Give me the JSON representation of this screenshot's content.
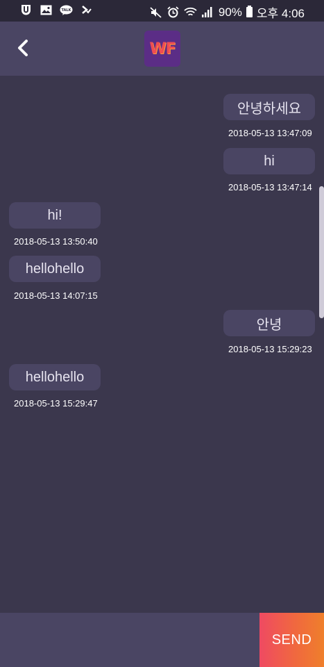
{
  "status_bar": {
    "battery_percent": "90%",
    "time": "오후 4:06",
    "left_icons": [
      "app-u-icon",
      "gallery-icon",
      "kakaotalk-icon",
      "checklist-icon"
    ],
    "right_icons": [
      "mute-icon",
      "alarm-icon",
      "wifi-icon",
      "signal-icon",
      "battery-icon"
    ]
  },
  "header": {
    "logo_text": "WF",
    "back_icon": "chevron-left-icon"
  },
  "messages": [
    {
      "side": "right",
      "text": "안녕하세요",
      "timestamp": "2018-05-13 13:47:09"
    },
    {
      "side": "right",
      "text": "hi",
      "timestamp": "2018-05-13 13:47:14"
    },
    {
      "side": "left",
      "text": "hi!",
      "timestamp": "2018-05-13 13:50:40"
    },
    {
      "side": "left",
      "text": "hellohello",
      "timestamp": "2018-05-13 14:07:15"
    },
    {
      "side": "right",
      "text": "안녕",
      "timestamp": "2018-05-13 15:29:23"
    },
    {
      "side": "left",
      "text": "hellohello",
      "timestamp": "2018-05-13 15:29:47"
    }
  ],
  "composer": {
    "value": "",
    "send_label": "SEND"
  },
  "colors": {
    "background": "#3b374d",
    "bubble": "#4a4563",
    "header": "#4a4563",
    "send_gradient_start": "#ef4a62",
    "send_gradient_end": "#ef7f2b"
  }
}
